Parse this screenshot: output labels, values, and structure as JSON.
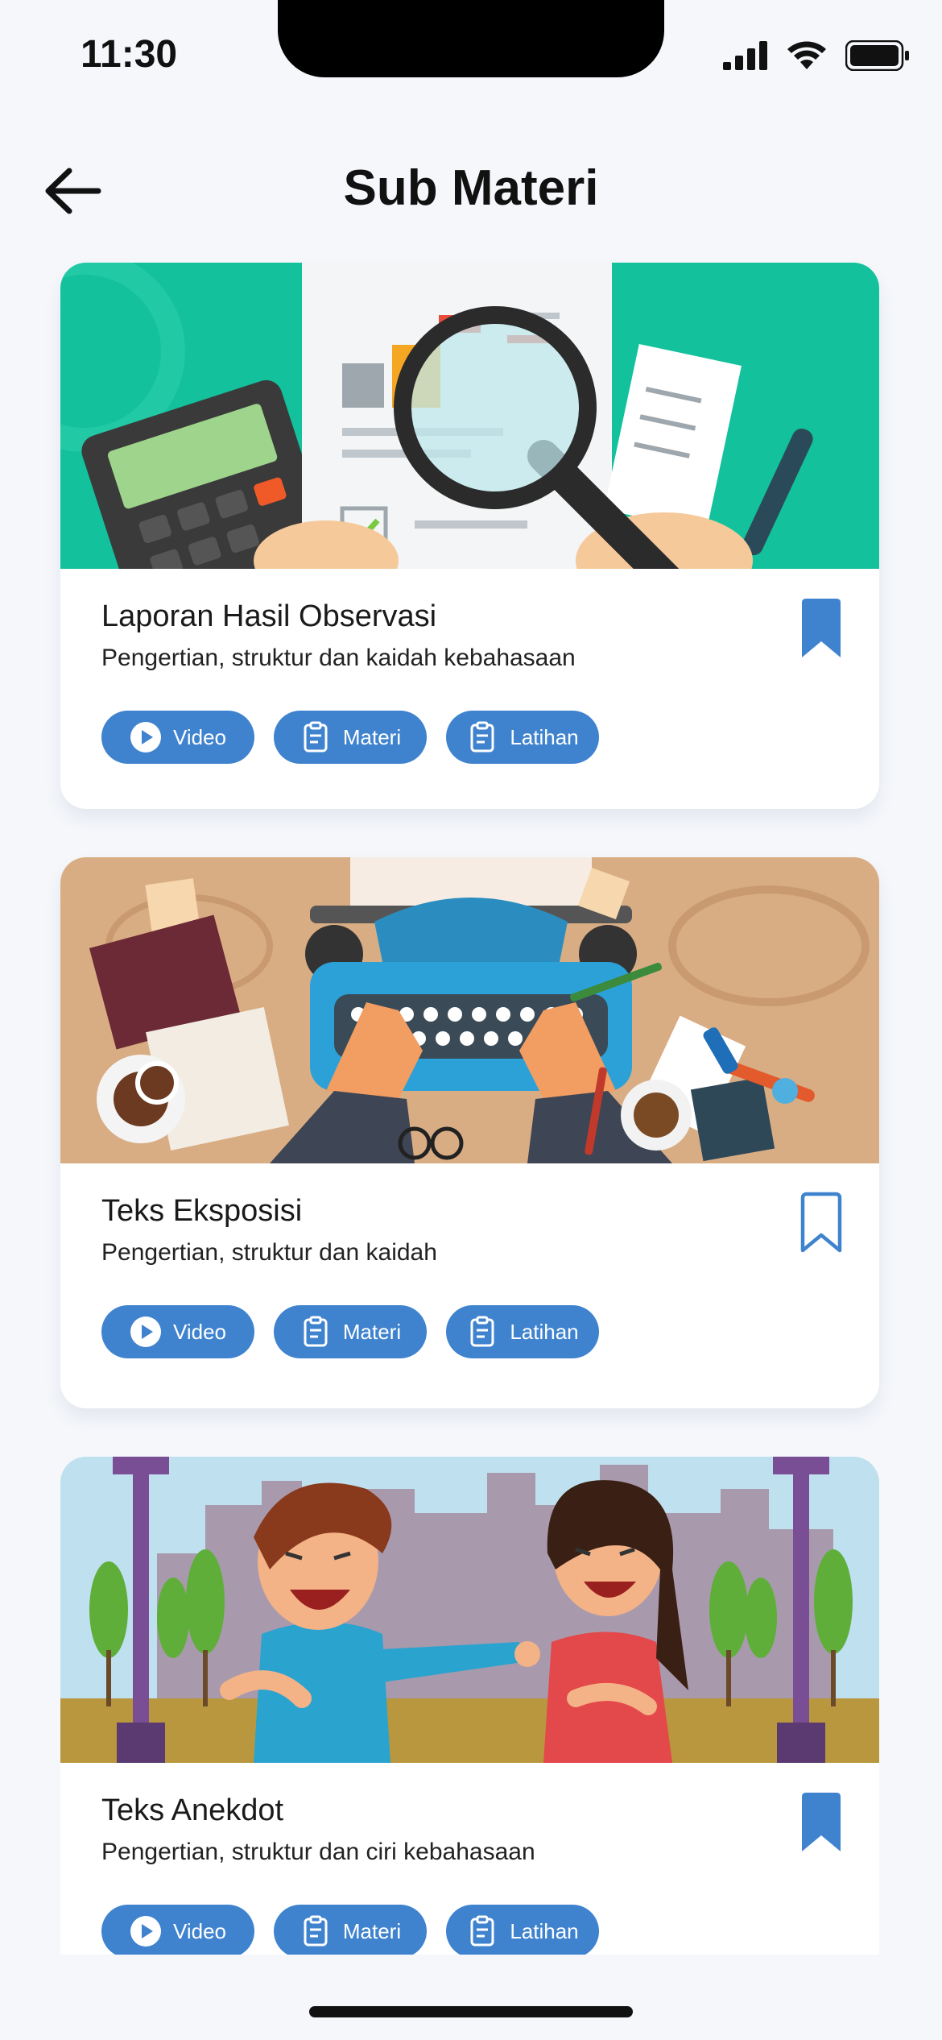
{
  "status_bar": {
    "time": "11:30",
    "icons": [
      "signal-icon",
      "wifi-icon",
      "battery-icon"
    ]
  },
  "header": {
    "title": "Sub Materi",
    "back_icon": "arrow-left-icon"
  },
  "colors": {
    "accent": "#3f83cf",
    "background": "#f5f7fb",
    "card": "#ffffff"
  },
  "cards": [
    {
      "title": "Laporan Hasil Observasi",
      "subtitle": "Pengertian, struktur dan kaidah kebahasaan",
      "bookmarked": true,
      "actions": [
        "Video",
        "Materi",
        "Latihan"
      ]
    },
    {
      "title": "Teks Eksposisi",
      "subtitle": "Pengertian, struktur  dan kaidah",
      "bookmarked": false,
      "actions": [
        "Video",
        "Materi",
        "Latihan"
      ]
    },
    {
      "title": "Teks Anekdot",
      "subtitle": "Pengertian, struktur dan ciri kebahasaan",
      "bookmarked": true,
      "actions": [
        "Video",
        "Materi",
        "Latihan"
      ]
    }
  ]
}
